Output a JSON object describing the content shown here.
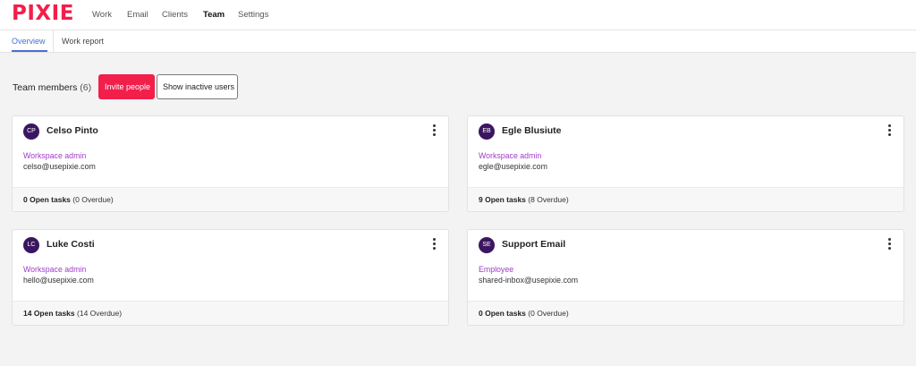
{
  "app": {
    "logo_text": "PIXIE",
    "logo_color": "#f21f4b"
  },
  "nav": {
    "items": [
      {
        "label": "Work"
      },
      {
        "label": "Email"
      },
      {
        "label": "Clients"
      },
      {
        "label": "Team",
        "active": true
      },
      {
        "label": "Settings"
      }
    ]
  },
  "subnav": {
    "tabs": [
      {
        "label": "Overview",
        "active": true
      },
      {
        "label": "Work report"
      }
    ]
  },
  "team": {
    "title": "Team members",
    "count": "(6)",
    "invite_label": "Invite people",
    "inactive_label": "Show inactive users"
  },
  "members": [
    {
      "initials": "CP",
      "name": "Celso Pinto",
      "role": "Workspace admin",
      "email": "celso@usepixie.com",
      "open_tasks": "0 Open tasks",
      "overdue": "(0 Overdue)"
    },
    {
      "initials": "EB",
      "name": "Egle Blusiute",
      "role": "Workspace admin",
      "email": "egle@usepixie.com",
      "open_tasks": "9 Open tasks",
      "overdue": "(8 Overdue)"
    },
    {
      "initials": "LC",
      "name": "Luke Costi",
      "role": "Workspace admin",
      "email": "hello@usepixie.com",
      "open_tasks": "14 Open tasks",
      "overdue": "(14 Overdue)"
    },
    {
      "initials": "SE",
      "name": "Support Email",
      "role": "Employee",
      "email": "shared-inbox@usepixie.com",
      "open_tasks": "0 Open tasks",
      "overdue": "(0 Overdue)"
    }
  ],
  "colors": {
    "accent": "#f21f4b",
    "tab_active": "#4a6fd0",
    "avatar_bg": "#3b1660",
    "role_text": "#a13cc8"
  }
}
